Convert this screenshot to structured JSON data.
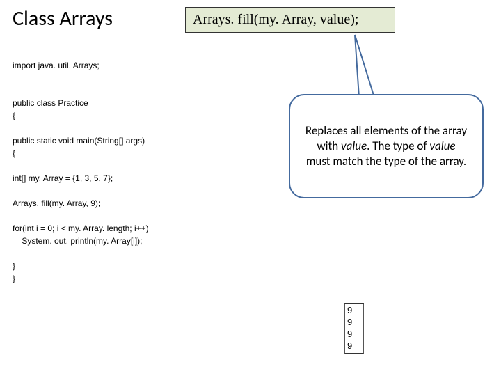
{
  "title": "Class Arrays",
  "method_signature": "Arrays. fill(my. Array, value);",
  "code": {
    "l1": "import java. util. Arrays;",
    "l2": "public class Practice",
    "l3": "{",
    "l4": "public static void main(String[] args)",
    "l5": "{",
    "l6": "int[] my. Array = {1, 3, 5, 7};",
    "l7": "Arrays. fill(my. Array, 9);",
    "l8": "for(int i = 0; i < my. Array. length; i++)",
    "l9": "    System. out. println(my. Array[i]);",
    "l10": "}",
    "l11": "}"
  },
  "callout": {
    "part1": "Replaces all elements of the array with ",
    "value1": "value",
    "part2": ".   The type of ",
    "value2": "value",
    "part3": " must match the type of the array."
  },
  "output": [
    "9",
    "9",
    "9",
    "9"
  ]
}
